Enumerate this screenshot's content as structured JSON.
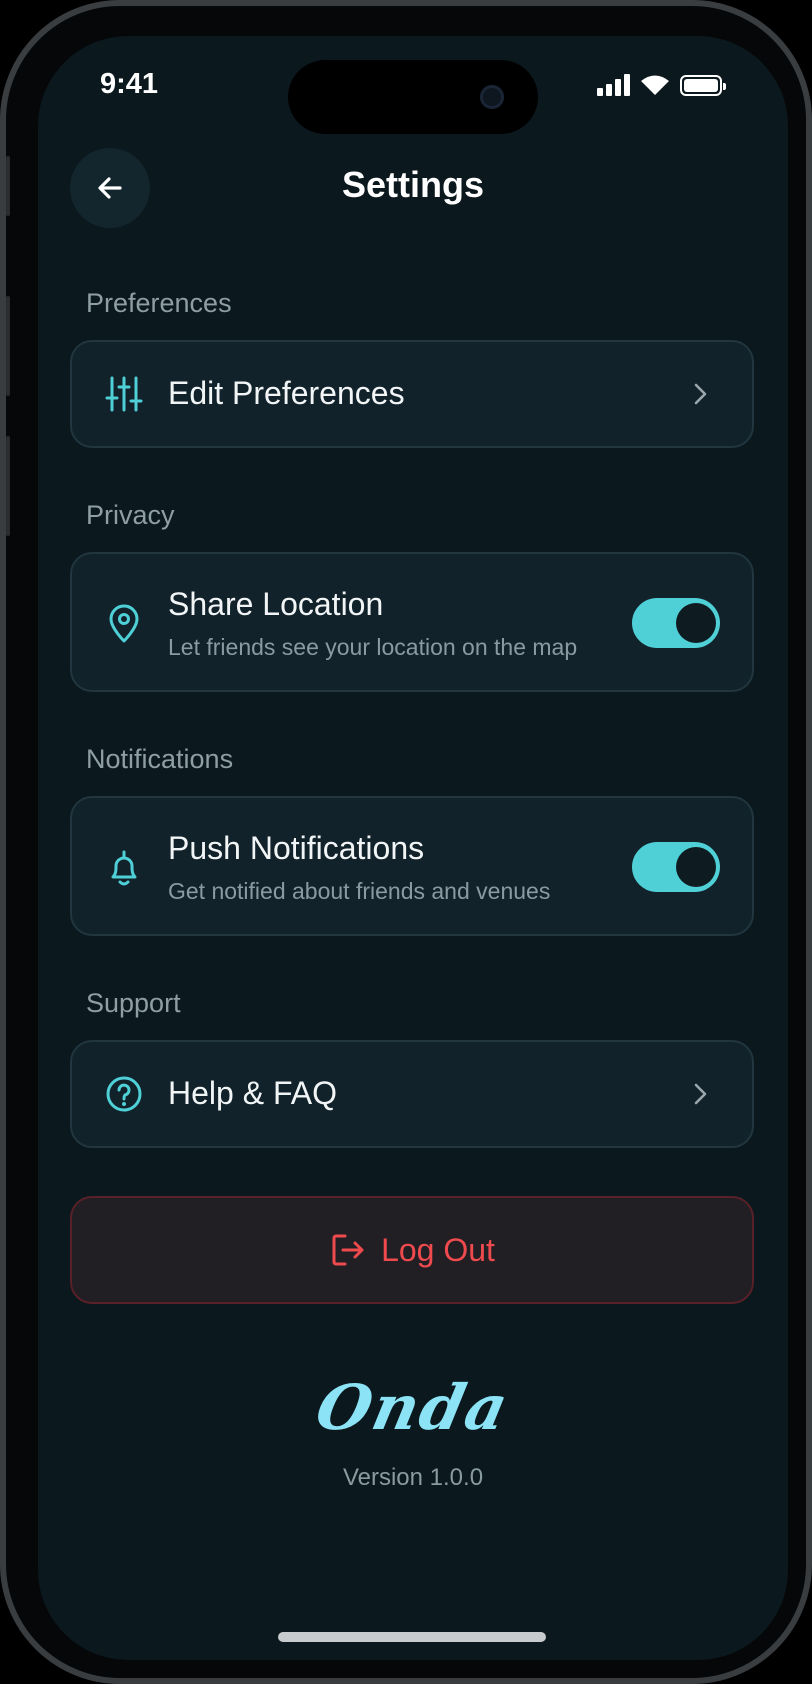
{
  "status_bar": {
    "time": "9:41"
  },
  "header": {
    "title": "Settings",
    "back_icon": "arrow-left-icon"
  },
  "sections": {
    "preferences": {
      "label": "Preferences",
      "edit": {
        "title": "Edit Preferences",
        "icon": "sliders-icon"
      }
    },
    "privacy": {
      "label": "Privacy",
      "share_location": {
        "title": "Share Location",
        "subtitle": "Let friends see your location on the map",
        "icon": "map-pin-icon",
        "enabled": true
      }
    },
    "notifications": {
      "label": "Notifications",
      "push": {
        "title": "Push Notifications",
        "subtitle": "Get notified about friends and venues",
        "icon": "bell-icon",
        "enabled": true
      }
    },
    "support": {
      "label": "Support",
      "help": {
        "title": "Help & FAQ",
        "icon": "question-circle-icon"
      }
    }
  },
  "logout": {
    "label": "Log Out",
    "icon": "logout-icon"
  },
  "footer": {
    "brand": "Onda",
    "version": "Version 1.0.0"
  },
  "colors": {
    "background": "#0b181e",
    "card": "#11222a",
    "accent": "#4fd0d6",
    "danger": "#ef4a4e",
    "brand": "#8be3f5"
  }
}
